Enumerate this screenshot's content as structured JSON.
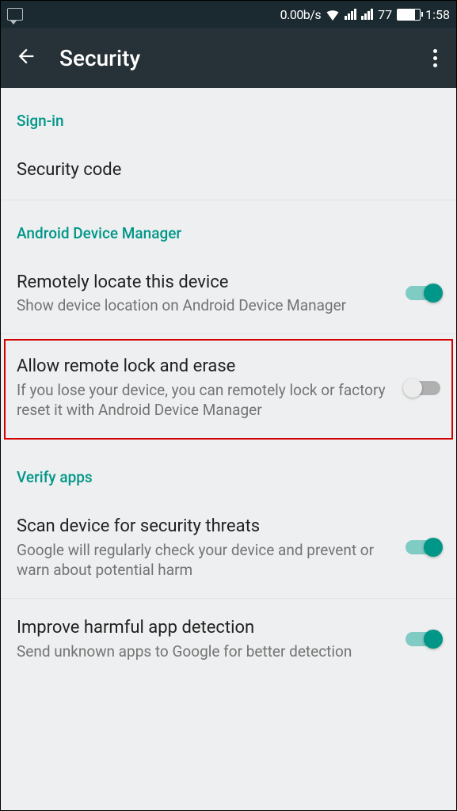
{
  "status_bar": {
    "speed": "0.00b/s",
    "battery_pct": "77",
    "time": "1:58"
  },
  "app_bar": {
    "title": "Security"
  },
  "sections": {
    "sign_in": {
      "header": "Sign-in",
      "security_code": "Security code"
    },
    "adm": {
      "header": "Android Device Manager",
      "locate_title": "Remotely locate this device",
      "locate_subtitle": "Show device location on Android Device Manager",
      "lock_title": "Allow remote lock and erase",
      "lock_subtitle": "If you lose your device, you can remotely lock or factory reset it with Android Device Manager"
    },
    "verify": {
      "header": "Verify apps",
      "scan_title": "Scan device for security threats",
      "scan_subtitle": "Google will regularly check your device and prevent or warn about potential harm",
      "improve_title": "Improve harmful app detection",
      "improve_subtitle": "Send unknown apps to Google for better detection"
    }
  }
}
